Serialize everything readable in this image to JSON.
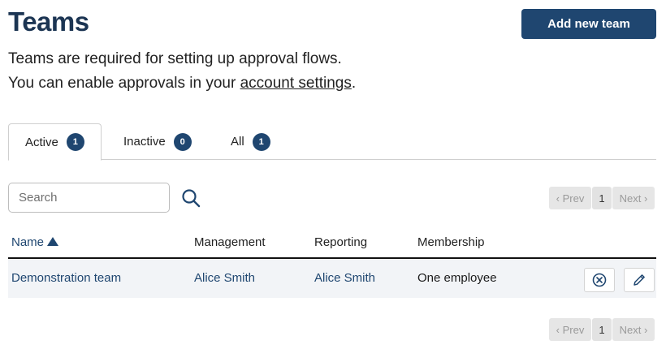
{
  "header": {
    "title": "Teams",
    "description_line1": "Teams are required for setting up approval flows.",
    "description_line2_prefix": "You can enable approvals in your ",
    "description_link": "account settings",
    "description_line2_suffix": ".",
    "add_button": "Add new team"
  },
  "tabs": [
    {
      "label": "Active",
      "count": "1",
      "active": true
    },
    {
      "label": "Inactive",
      "count": "0",
      "active": false
    },
    {
      "label": "All",
      "count": "1",
      "active": false
    }
  ],
  "search": {
    "placeholder": "Search"
  },
  "pagination": {
    "prev": "‹ Prev",
    "page": "1",
    "next": "Next ›"
  },
  "table": {
    "columns": [
      "Name",
      "Management",
      "Reporting",
      "Membership"
    ],
    "rows": [
      {
        "name": "Demonstration team",
        "management": "Alice Smith",
        "reporting": "Alice Smith",
        "membership": "One employee"
      }
    ]
  },
  "colors": {
    "brand": "#1f4670",
    "title": "#1c3553",
    "row_bg": "#f2f4f7"
  },
  "icons": {
    "search": "search-icon",
    "deactivate": "close-circle-icon",
    "edit": "pencil-icon",
    "sort": "sort-ascending-icon"
  }
}
